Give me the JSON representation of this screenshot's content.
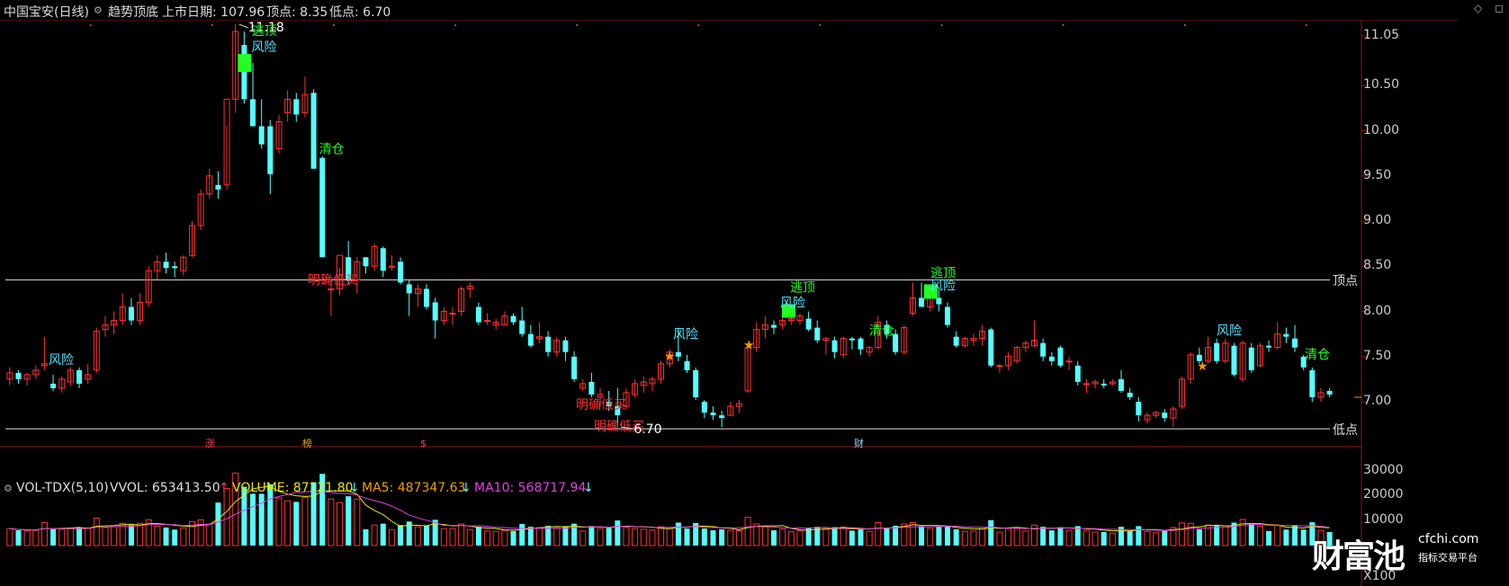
{
  "header": {
    "title": "中国宝安(日线)",
    "indicator": "趋势顶底",
    "listing_label": "上市日期: 107.96",
    "top_label": "顶点: 8.35",
    "low_label": "低点: 6.70"
  },
  "price_axis": {
    "ticks": [
      "11.05",
      "10.50",
      "10.00",
      "9.50",
      "9.00",
      "8.50",
      "8.00",
      "7.50",
      "7.00"
    ],
    "top_line_label": "顶点",
    "low_line_label": "低点"
  },
  "markers": {
    "high_value": "11.18",
    "low_value": "6.70"
  },
  "signals": {
    "risk": "风险",
    "escape_top": "逃顶",
    "clear": "清仓",
    "buy": "明确低买",
    "star": "★"
  },
  "event_tags": {
    "zhang": "涨",
    "bang": "榜",
    "dollar": "$",
    "cai": "财"
  },
  "volume": {
    "name": "VOL-TDX(5,10)",
    "vvol": "VVOL: 653413.50",
    "vvol_arrow": "↑",
    "volume": "VOLUME: 87121.80",
    "volume_arrow": "↓",
    "ma5": "MA5: 487347.63",
    "ma5_arrow": "↓",
    "ma10": "MA10: 568717.94",
    "ma10_arrow": "↓",
    "ticks": [
      "30000",
      "20000",
      "10000"
    ],
    "unit": "X100"
  },
  "logo": {
    "brand": "财富池",
    "site": "cfchi.com",
    "sub": "指标交易平台"
  },
  "colors": {
    "up": "#ff3232",
    "down": "#54ffff",
    "risk": "#54e0ff",
    "signal_green": "#22ff22",
    "buy_red": "#ff2b2b",
    "ma5": "#e8e800",
    "ma10": "#e040e0",
    "hline": "#e0e0e0"
  },
  "chart_data": {
    "type": "candlestick",
    "title": "中国宝安(日线)",
    "ylim": [
      6.55,
      11.2
    ],
    "top_line": 8.35,
    "low_line": 6.7,
    "high_marker": 11.18,
    "low_marker": 6.7,
    "candles": [
      {
        "o": 7.25,
        "h": 7.38,
        "l": 7.18,
        "c": 7.32
      },
      {
        "o": 7.32,
        "h": 7.35,
        "l": 7.2,
        "c": 7.25
      },
      {
        "o": 7.25,
        "h": 7.32,
        "l": 7.18,
        "c": 7.3
      },
      {
        "o": 7.3,
        "h": 7.4,
        "l": 7.25,
        "c": 7.35
      },
      {
        "o": 7.4,
        "h": 7.72,
        "l": 7.35,
        "c": 7.42
      },
      {
        "o": 7.2,
        "h": 7.3,
        "l": 7.12,
        "c": 7.15
      },
      {
        "o": 7.15,
        "h": 7.28,
        "l": 7.1,
        "c": 7.25
      },
      {
        "o": 7.22,
        "h": 7.38,
        "l": 7.18,
        "c": 7.35
      },
      {
        "o": 7.35,
        "h": 7.38,
        "l": 7.15,
        "c": 7.2
      },
      {
        "o": 7.25,
        "h": 7.42,
        "l": 7.2,
        "c": 7.3
      },
      {
        "o": 7.35,
        "h": 7.82,
        "l": 7.32,
        "c": 7.78
      },
      {
        "o": 7.8,
        "h": 7.95,
        "l": 7.72,
        "c": 7.85
      },
      {
        "o": 7.85,
        "h": 8.0,
        "l": 7.75,
        "c": 7.9
      },
      {
        "o": 7.9,
        "h": 8.2,
        "l": 7.85,
        "c": 8.05
      },
      {
        "o": 8.05,
        "h": 8.15,
        "l": 7.85,
        "c": 7.9
      },
      {
        "o": 7.9,
        "h": 8.2,
        "l": 7.85,
        "c": 8.1
      },
      {
        "o": 8.1,
        "h": 8.5,
        "l": 8.05,
        "c": 8.45
      },
      {
        "o": 8.45,
        "h": 8.62,
        "l": 8.35,
        "c": 8.55
      },
      {
        "o": 8.55,
        "h": 8.65,
        "l": 8.42,
        "c": 8.48
      },
      {
        "o": 8.5,
        "h": 8.55,
        "l": 8.38,
        "c": 8.48
      },
      {
        "o": 8.45,
        "h": 8.62,
        "l": 8.4,
        "c": 8.6
      },
      {
        "o": 8.62,
        "h": 9.0,
        "l": 8.6,
        "c": 8.95
      },
      {
        "o": 8.95,
        "h": 9.35,
        "l": 8.9,
        "c": 9.3
      },
      {
        "o": 9.3,
        "h": 9.58,
        "l": 9.25,
        "c": 9.5
      },
      {
        "o": 9.4,
        "h": 9.55,
        "l": 9.25,
        "c": 9.35
      },
      {
        "o": 9.4,
        "h": 10.05,
        "l": 9.35,
        "c": 10.35
      },
      {
        "o": 10.35,
        "h": 11.18,
        "l": 10.2,
        "c": 11.1
      },
      {
        "o": 10.95,
        "h": 11.1,
        "l": 10.3,
        "c": 10.35
      },
      {
        "o": 10.35,
        "h": 10.75,
        "l": 10.2,
        "c": 10.05
      },
      {
        "o": 10.05,
        "h": 10.35,
        "l": 9.8,
        "c": 9.85
      },
      {
        "o": 10.05,
        "h": 10.12,
        "l": 9.3,
        "c": 9.52
      },
      {
        "o": 9.8,
        "h": 10.18,
        "l": 9.75,
        "c": 10.1
      },
      {
        "o": 10.2,
        "h": 10.45,
        "l": 10.1,
        "c": 10.35
      },
      {
        "o": 10.35,
        "h": 10.42,
        "l": 10.1,
        "c": 10.18
      },
      {
        "o": 10.2,
        "h": 10.6,
        "l": 10.15,
        "c": 10.4
      },
      {
        "o": 10.42,
        "h": 10.46,
        "l": 9.58,
        "c": 9.58
      },
      {
        "o": 9.7,
        "h": 9.72,
        "l": 8.6,
        "c": 8.6
      },
      {
        "o": 8.25,
        "h": 8.35,
        "l": 7.95,
        "c": 8.25
      },
      {
        "o": 8.25,
        "h": 8.48,
        "l": 8.18,
        "c": 8.62
      },
      {
        "o": 8.6,
        "h": 8.78,
        "l": 8.3,
        "c": 8.35
      },
      {
        "o": 8.35,
        "h": 8.6,
        "l": 8.2,
        "c": 8.55
      },
      {
        "o": 8.6,
        "h": 8.6,
        "l": 8.42,
        "c": 8.5
      },
      {
        "o": 8.5,
        "h": 8.75,
        "l": 8.45,
        "c": 8.72
      },
      {
        "o": 8.7,
        "h": 8.72,
        "l": 8.38,
        "c": 8.45
      },
      {
        "o": 8.5,
        "h": 8.62,
        "l": 8.45,
        "c": 8.5
      },
      {
        "o": 8.55,
        "h": 8.6,
        "l": 8.3,
        "c": 8.32
      },
      {
        "o": 8.3,
        "h": 8.35,
        "l": 7.95,
        "c": 8.2
      },
      {
        "o": 8.2,
        "h": 8.3,
        "l": 8.05,
        "c": 8.25
      },
      {
        "o": 8.25,
        "h": 8.3,
        "l": 8.02,
        "c": 8.05
      },
      {
        "o": 8.1,
        "h": 8.15,
        "l": 7.7,
        "c": 7.9
      },
      {
        "o": 7.9,
        "h": 8.05,
        "l": 7.85,
        "c": 8.0
      },
      {
        "o": 7.98,
        "h": 8.05,
        "l": 7.85,
        "c": 7.98
      },
      {
        "o": 8.0,
        "h": 8.28,
        "l": 7.95,
        "c": 8.25
      },
      {
        "o": 8.25,
        "h": 8.32,
        "l": 8.15,
        "c": 8.28
      },
      {
        "o": 8.05,
        "h": 8.1,
        "l": 7.85,
        "c": 7.88
      },
      {
        "o": 7.9,
        "h": 7.98,
        "l": 7.85,
        "c": 7.9
      },
      {
        "o": 7.85,
        "h": 7.92,
        "l": 7.8,
        "c": 7.88
      },
      {
        "o": 7.85,
        "h": 8.0,
        "l": 7.85,
        "c": 7.95
      },
      {
        "o": 7.95,
        "h": 7.98,
        "l": 7.85,
        "c": 7.88
      },
      {
        "o": 7.9,
        "h": 8.05,
        "l": 7.72,
        "c": 7.75
      },
      {
        "o": 7.75,
        "h": 7.85,
        "l": 7.6,
        "c": 7.62
      },
      {
        "o": 7.7,
        "h": 7.88,
        "l": 7.65,
        "c": 7.72
      },
      {
        "o": 7.72,
        "h": 7.78,
        "l": 7.5,
        "c": 7.55
      },
      {
        "o": 7.55,
        "h": 7.72,
        "l": 7.5,
        "c": 7.68
      },
      {
        "o": 7.68,
        "h": 7.72,
        "l": 7.45,
        "c": 7.55
      },
      {
        "o": 7.5,
        "h": 7.56,
        "l": 7.22,
        "c": 7.25
      },
      {
        "o": 7.15,
        "h": 7.25,
        "l": 7.12,
        "c": 7.2
      },
      {
        "o": 7.22,
        "h": 7.32,
        "l": 7.05,
        "c": 7.08
      },
      {
        "o": 7.05,
        "h": 7.15,
        "l": 6.95,
        "c": 7.08
      },
      {
        "o": 7.0,
        "h": 7.12,
        "l": 6.9,
        "c": 6.95
      },
      {
        "o": 6.95,
        "h": 7.15,
        "l": 6.72,
        "c": 6.85
      },
      {
        "o": 6.95,
        "h": 7.15,
        "l": 6.92,
        "c": 7.1
      },
      {
        "o": 7.08,
        "h": 7.25,
        "l": 7.05,
        "c": 7.2
      },
      {
        "o": 7.18,
        "h": 7.28,
        "l": 7.1,
        "c": 7.22
      },
      {
        "o": 7.2,
        "h": 7.28,
        "l": 7.12,
        "c": 7.25
      },
      {
        "o": 7.25,
        "h": 7.45,
        "l": 7.2,
        "c": 7.42
      },
      {
        "o": 7.42,
        "h": 7.58,
        "l": 7.38,
        "c": 7.55
      },
      {
        "o": 7.55,
        "h": 7.82,
        "l": 7.45,
        "c": 7.5
      },
      {
        "o": 7.45,
        "h": 7.52,
        "l": 7.32,
        "c": 7.35
      },
      {
        "o": 7.35,
        "h": 7.38,
        "l": 7.02,
        "c": 7.05
      },
      {
        "o": 7.0,
        "h": 7.02,
        "l": 6.82,
        "c": 6.88
      },
      {
        "o": 6.88,
        "h": 6.95,
        "l": 6.8,
        "c": 6.85
      },
      {
        "o": 6.85,
        "h": 6.9,
        "l": 6.72,
        "c": 6.82
      },
      {
        "o": 6.85,
        "h": 7.0,
        "l": 6.85,
        "c": 6.95
      },
      {
        "o": 6.95,
        "h": 7.02,
        "l": 6.88,
        "c": 6.98
      },
      {
        "o": 7.12,
        "h": 7.62,
        "l": 7.1,
        "c": 7.6
      },
      {
        "o": 7.6,
        "h": 7.88,
        "l": 7.55,
        "c": 7.8
      },
      {
        "o": 7.8,
        "h": 7.95,
        "l": 7.7,
        "c": 7.85
      },
      {
        "o": 7.85,
        "h": 7.9,
        "l": 7.75,
        "c": 7.82
      },
      {
        "o": 7.85,
        "h": 7.98,
        "l": 7.8,
        "c": 7.9
      },
      {
        "o": 7.9,
        "h": 7.96,
        "l": 7.85,
        "c": 7.92
      },
      {
        "o": 7.9,
        "h": 7.98,
        "l": 7.85,
        "c": 7.95
      },
      {
        "o": 7.92,
        "h": 8.0,
        "l": 7.78,
        "c": 7.8
      },
      {
        "o": 7.82,
        "h": 7.9,
        "l": 7.65,
        "c": 7.68
      },
      {
        "o": 7.68,
        "h": 7.72,
        "l": 7.52,
        "c": 7.7
      },
      {
        "o": 7.68,
        "h": 7.72,
        "l": 7.48,
        "c": 7.55
      },
      {
        "o": 7.52,
        "h": 7.72,
        "l": 7.48,
        "c": 7.7
      },
      {
        "o": 7.7,
        "h": 7.72,
        "l": 7.58,
        "c": 7.68
      },
      {
        "o": 7.7,
        "h": 7.72,
        "l": 7.52,
        "c": 7.58
      },
      {
        "o": 7.55,
        "h": 7.62,
        "l": 7.5,
        "c": 7.6
      },
      {
        "o": 7.6,
        "h": 7.95,
        "l": 7.58,
        "c": 7.88
      },
      {
        "o": 7.85,
        "h": 7.9,
        "l": 7.7,
        "c": 7.75
      },
      {
        "o": 7.75,
        "h": 7.8,
        "l": 7.52,
        "c": 7.55
      },
      {
        "o": 7.55,
        "h": 7.85,
        "l": 7.52,
        "c": 7.82
      },
      {
        "o": 7.98,
        "h": 8.32,
        "l": 7.95,
        "c": 8.15
      },
      {
        "o": 8.15,
        "h": 8.32,
        "l": 8.05,
        "c": 8.05
      },
      {
        "o": 8.05,
        "h": 8.2,
        "l": 8.0,
        "c": 8.15
      },
      {
        "o": 8.15,
        "h": 8.25,
        "l": 8.0,
        "c": 8.08
      },
      {
        "o": 8.05,
        "h": 8.1,
        "l": 7.82,
        "c": 7.85
      },
      {
        "o": 7.72,
        "h": 7.78,
        "l": 7.6,
        "c": 7.62
      },
      {
        "o": 7.62,
        "h": 7.72,
        "l": 7.6,
        "c": 7.7
      },
      {
        "o": 7.68,
        "h": 7.75,
        "l": 7.62,
        "c": 7.7
      },
      {
        "o": 7.7,
        "h": 7.85,
        "l": 7.62,
        "c": 7.78
      },
      {
        "o": 7.8,
        "h": 7.82,
        "l": 7.38,
        "c": 7.4
      },
      {
        "o": 7.4,
        "h": 7.42,
        "l": 7.32,
        "c": 7.4
      },
      {
        "o": 7.4,
        "h": 7.55,
        "l": 7.35,
        "c": 7.5
      },
      {
        "o": 7.45,
        "h": 7.62,
        "l": 7.42,
        "c": 7.6
      },
      {
        "o": 7.6,
        "h": 7.68,
        "l": 7.55,
        "c": 7.65
      },
      {
        "o": 7.62,
        "h": 7.9,
        "l": 7.6,
        "c": 7.68
      },
      {
        "o": 7.65,
        "h": 7.7,
        "l": 7.45,
        "c": 7.5
      },
      {
        "o": 7.5,
        "h": 7.55,
        "l": 7.4,
        "c": 7.45
      },
      {
        "o": 7.6,
        "h": 7.62,
        "l": 7.38,
        "c": 7.4
      },
      {
        "o": 7.45,
        "h": 7.5,
        "l": 7.35,
        "c": 7.45
      },
      {
        "o": 7.4,
        "h": 7.45,
        "l": 7.18,
        "c": 7.22
      },
      {
        "o": 7.2,
        "h": 7.25,
        "l": 7.1,
        "c": 7.2
      },
      {
        "o": 7.2,
        "h": 7.25,
        "l": 7.15,
        "c": 7.22
      },
      {
        "o": 7.2,
        "h": 7.25,
        "l": 7.15,
        "c": 7.18
      },
      {
        "o": 7.2,
        "h": 7.25,
        "l": 7.18,
        "c": 7.22
      },
      {
        "o": 7.25,
        "h": 7.35,
        "l": 7.1,
        "c": 7.12
      },
      {
        "o": 7.1,
        "h": 7.15,
        "l": 7.02,
        "c": 7.05
      },
      {
        "o": 7.0,
        "h": 7.05,
        "l": 6.78,
        "c": 6.85
      },
      {
        "o": 6.8,
        "h": 6.88,
        "l": 6.76,
        "c": 6.85
      },
      {
        "o": 6.85,
        "h": 6.9,
        "l": 6.82,
        "c": 6.88
      },
      {
        "o": 6.88,
        "h": 6.92,
        "l": 6.78,
        "c": 6.82
      },
      {
        "o": 6.82,
        "h": 6.95,
        "l": 6.72,
        "c": 6.92
      },
      {
        "o": 6.95,
        "h": 7.28,
        "l": 6.92,
        "c": 7.25
      },
      {
        "o": 7.25,
        "h": 7.55,
        "l": 7.2,
        "c": 7.52
      },
      {
        "o": 7.52,
        "h": 7.6,
        "l": 7.42,
        "c": 7.45
      },
      {
        "o": 7.45,
        "h": 7.72,
        "l": 7.42,
        "c": 7.6
      },
      {
        "o": 7.65,
        "h": 7.7,
        "l": 7.42,
        "c": 7.45
      },
      {
        "o": 7.45,
        "h": 7.7,
        "l": 7.42,
        "c": 7.65
      },
      {
        "o": 7.62,
        "h": 7.65,
        "l": 7.28,
        "c": 7.3
      },
      {
        "o": 7.25,
        "h": 7.68,
        "l": 7.22,
        "c": 7.65
      },
      {
        "o": 7.6,
        "h": 7.65,
        "l": 7.32,
        "c": 7.35
      },
      {
        "o": 7.4,
        "h": 7.65,
        "l": 7.38,
        "c": 7.62
      },
      {
        "o": 7.62,
        "h": 7.68,
        "l": 7.55,
        "c": 7.6
      },
      {
        "o": 7.6,
        "h": 7.88,
        "l": 7.58,
        "c": 7.75
      },
      {
        "o": 7.75,
        "h": 7.82,
        "l": 7.65,
        "c": 7.72
      },
      {
        "o": 7.7,
        "h": 7.85,
        "l": 7.55,
        "c": 7.6
      },
      {
        "o": 7.5,
        "h": 7.52,
        "l": 7.35,
        "c": 7.38
      },
      {
        "o": 7.35,
        "h": 7.38,
        "l": 7.0,
        "c": 7.05
      },
      {
        "o": 7.05,
        "h": 7.15,
        "l": 7.0,
        "c": 7.1
      },
      {
        "o": 7.12,
        "h": 7.15,
        "l": 7.05,
        "c": 7.08
      }
    ],
    "volume": {
      "ylim": [
        0,
        32000
      ],
      "ticks": [
        10000,
        20000,
        30000
      ]
    }
  }
}
